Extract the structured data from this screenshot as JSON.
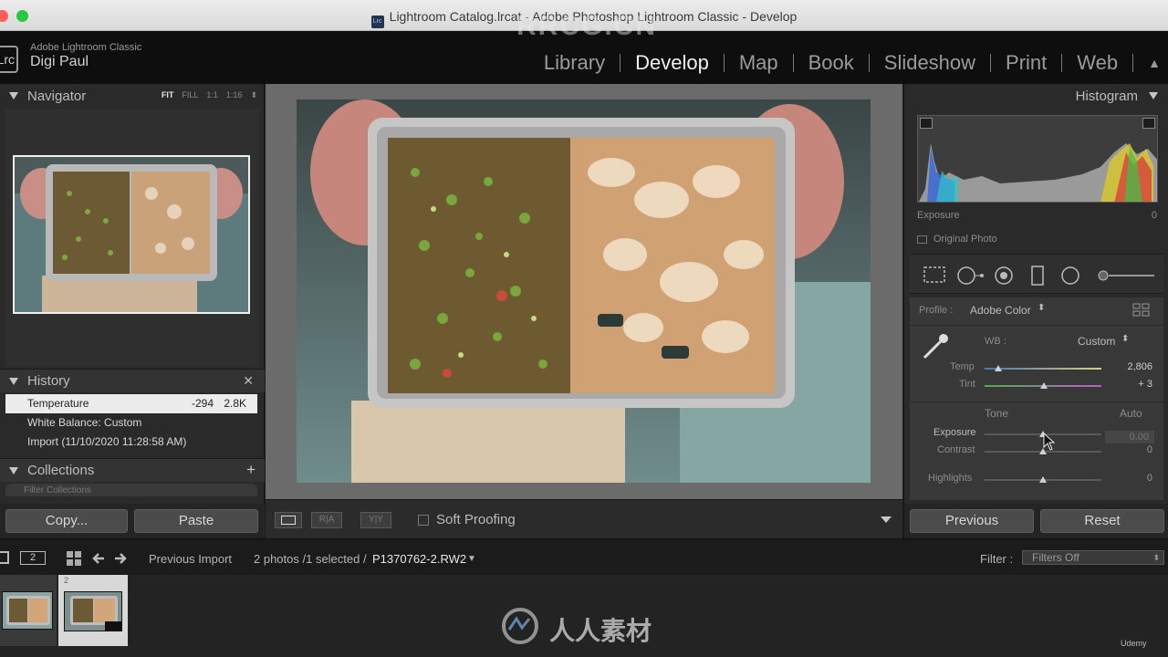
{
  "window": {
    "title": "Lightroom Catalog.lrcat - Adobe Photoshop Lightroom Classic - Develop"
  },
  "identity": {
    "app_name": "Adobe Lightroom Classic",
    "user_name": "Digi Paul",
    "logo_text": "Lrc"
  },
  "modules": [
    "Library",
    "Develop",
    "Map",
    "Book",
    "Slideshow",
    "Print",
    "Web"
  ],
  "active_module": "Develop",
  "navigator": {
    "title": "Navigator",
    "zoom": [
      "FIT",
      "FILL",
      "1:1",
      "1:16"
    ],
    "active_zoom": "FIT"
  },
  "history": {
    "title": "History",
    "items": [
      {
        "label": "Temperature",
        "from": "-294",
        "to": "2.8K",
        "selected": true
      },
      {
        "label": "White Balance: Custom",
        "from": "",
        "to": "",
        "selected": false
      },
      {
        "label": "Import (11/10/2020 11:28:58 AM)",
        "from": "",
        "to": "",
        "selected": false
      }
    ]
  },
  "collections": {
    "title": "Collections",
    "filter_placeholder": "Filter Collections"
  },
  "left_buttons": {
    "copy": "Copy...",
    "paste": "Paste"
  },
  "toolbar": {
    "soft_proofing": "Soft Proofing"
  },
  "histogram": {
    "title": "Histogram",
    "exposure_label": "Exposure",
    "exposure_value": "0",
    "original_photo": "Original Photo"
  },
  "basic": {
    "profile_label": "Profile :",
    "profile_value": "Adobe Color",
    "wb_label": "WB :",
    "wb_value": "Custom",
    "temp_label": "Temp",
    "temp_value": "2,806",
    "temp_level": 0.12,
    "tint_label": "Tint",
    "tint_value": "+ 3",
    "tint_level": 0.51,
    "tone_label": "Tone",
    "auto_label": "Auto",
    "exposure_label": "Exposure",
    "exposure_value": "0.00",
    "exposure_level": 0.5,
    "contrast_label": "Contrast",
    "contrast_value": "0",
    "contrast_level": 0.5,
    "highlights_label": "Highlights",
    "highlights_value": "0",
    "highlights_level": 0.5
  },
  "right_buttons": {
    "previous": "Previous",
    "reset": "Reset"
  },
  "filmstrip": {
    "page_number": "2",
    "source": "Previous Import",
    "count": "2 photos /1 selected /",
    "filename": "P1370762-2.RW2",
    "filter_label": "Filter :",
    "filter_value": "Filters Off",
    "cell_number": "2"
  },
  "watermarks": {
    "brand": "RRCG.CN",
    "site": "人人素材",
    "udemy": "Udemy"
  },
  "colors": {
    "accent": "#f0f0f0",
    "panel": "#2a2a2a",
    "selected_row": "#ececec"
  }
}
